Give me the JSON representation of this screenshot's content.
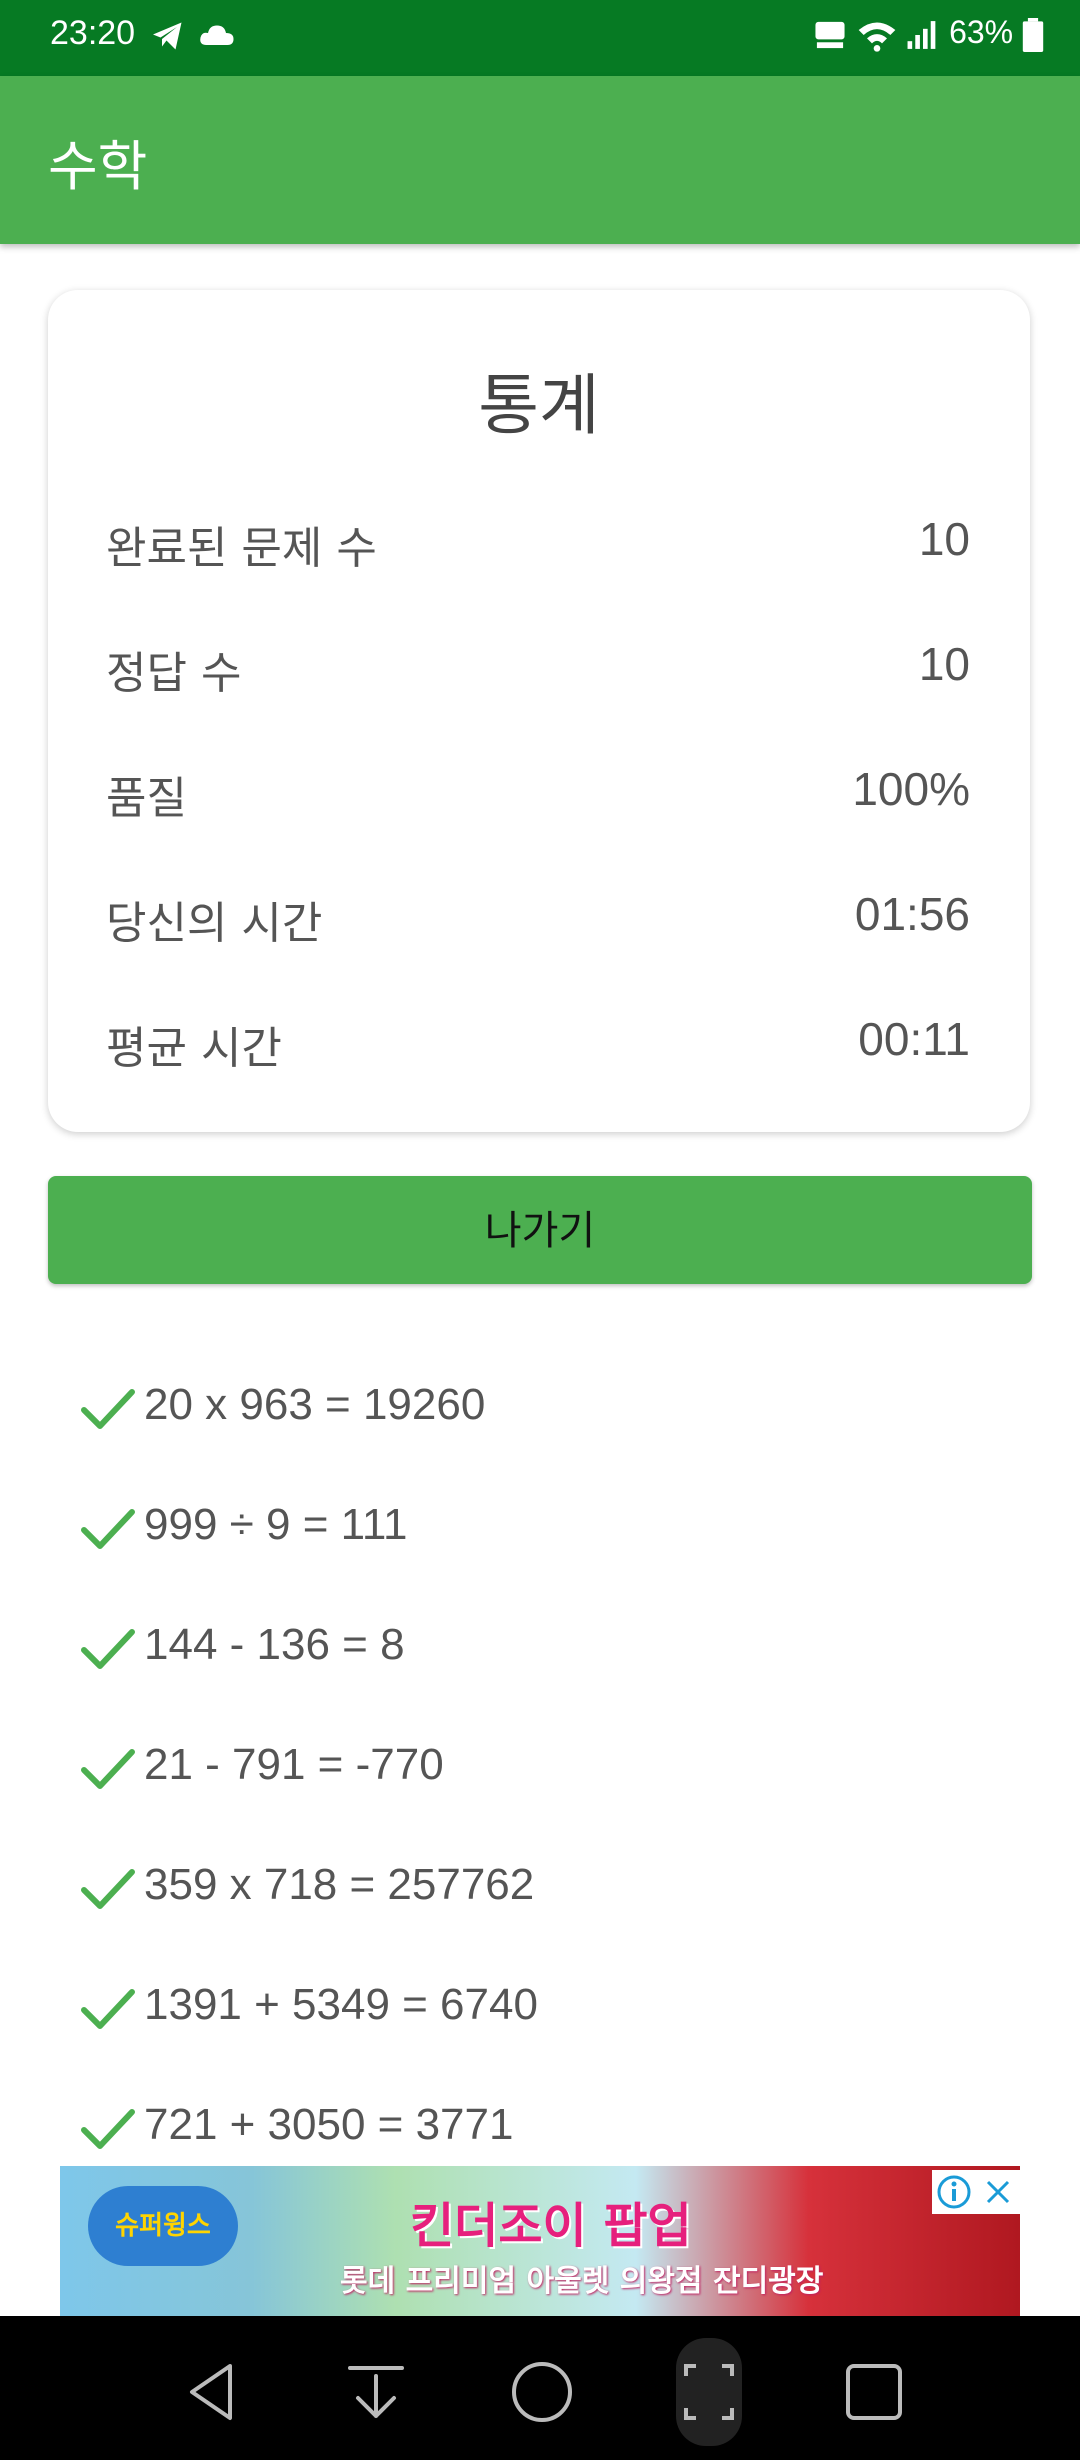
{
  "status_bar": {
    "time": "23:20",
    "battery": "63%",
    "left_icons": [
      "telegram-icon",
      "cloud-icon"
    ],
    "right_icons": [
      "hd-voice-icon",
      "wifi-icon",
      "signal-icon",
      "battery-icon"
    ]
  },
  "app_bar": {
    "title": "수학"
  },
  "stats": {
    "title": "통계",
    "rows": [
      {
        "label": "완료된 문제 수",
        "value": "10"
      },
      {
        "label": "정답 수",
        "value": "10"
      },
      {
        "label": "품질",
        "value": "100%"
      },
      {
        "label": "당신의 시간",
        "value": "01:56"
      },
      {
        "label": "평균 시간",
        "value": "00:11"
      }
    ]
  },
  "exit_button": {
    "label": "나가기"
  },
  "results": [
    {
      "expr": "20 x 963 = 19260",
      "correct": true
    },
    {
      "expr": "999 ÷ 9 = 111",
      "correct": true
    },
    {
      "expr": "144 - 136 = 8",
      "correct": true
    },
    {
      "expr": "21 - 791 = -770",
      "correct": true
    },
    {
      "expr": "359 x 718 = 257762",
      "correct": true
    },
    {
      "expr": "1391 + 5349 = 6740",
      "correct": true
    },
    {
      "expr": "721 + 3050 = 3771",
      "correct": true
    }
  ],
  "ad": {
    "left_logo": "슈퍼윙스",
    "headline": "킨더조이 팝업",
    "subline": "롯데 프리미엄 아울렛 의왕점 잔디광장"
  },
  "nav_bar": {
    "buttons": [
      "back-icon",
      "download-icon",
      "home-icon",
      "screenshot-icon",
      "recents-icon"
    ]
  },
  "colors": {
    "status_bar": "#067a23",
    "app_bar": "#4caf50",
    "check": "#4caf50",
    "text": "#555555"
  }
}
